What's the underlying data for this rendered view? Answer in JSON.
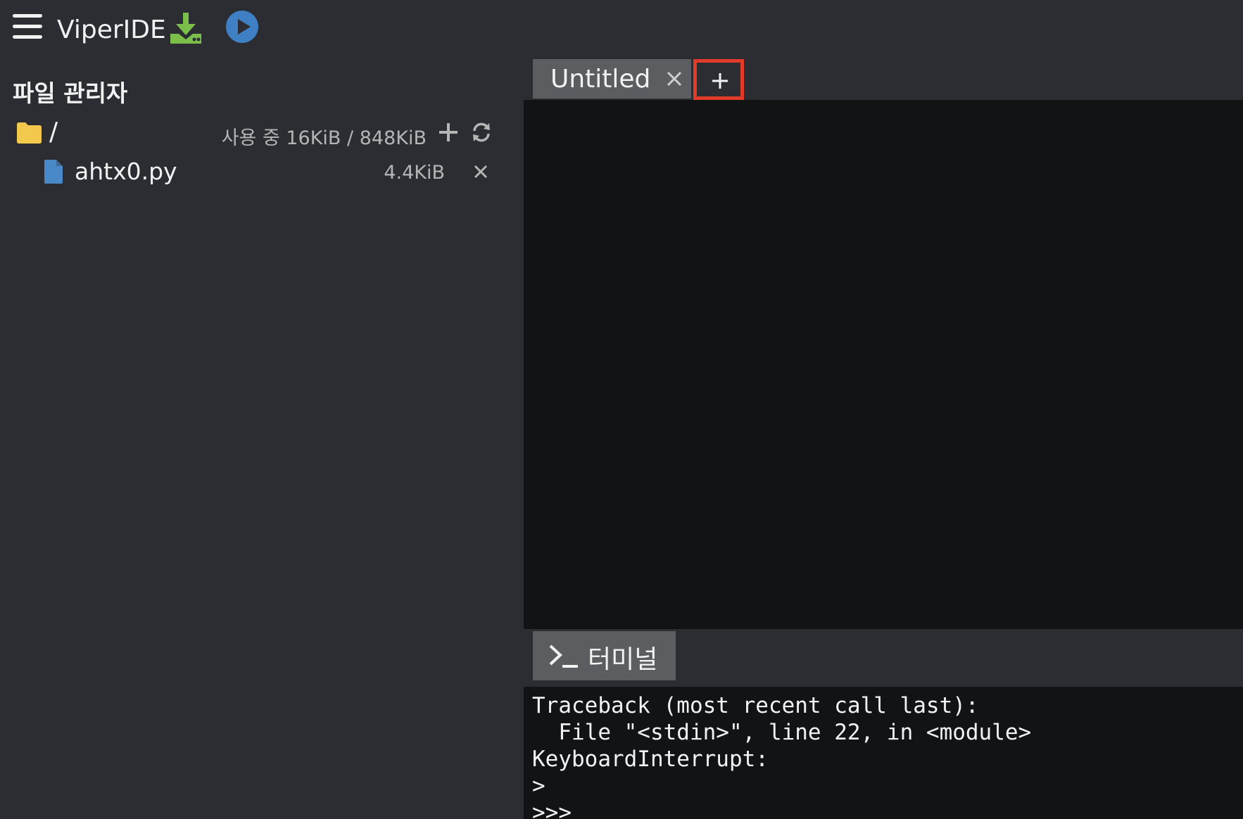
{
  "app": {
    "title": "ViperIDE",
    "icons": {
      "menu": "hamburger-menu-icon",
      "download": "download-icon",
      "run": "play-icon"
    },
    "colors": {
      "download_icon": "#7bbf4a",
      "run_icon": "#3f7fc4",
      "folder_icon": "#f2c94c",
      "file_icon": "#4a89c8",
      "highlight_border": "#e23b2a"
    }
  },
  "sidebar": {
    "heading": "파일 관리자",
    "root": {
      "label": "/",
      "usage": "사용 중 16KiB / 848KiB"
    },
    "files": [
      {
        "name": "ahtx0.py",
        "size": "4.4KiB"
      }
    ]
  },
  "editor": {
    "tabs": [
      {
        "label": "Untitled"
      }
    ],
    "new_tab_label": "+"
  },
  "terminal": {
    "tab_label": "터미널",
    "output": "Traceback (most recent call last):\n  File \"<stdin>\", line 22, in <module>\nKeyboardInterrupt:\n>\n>>>"
  }
}
